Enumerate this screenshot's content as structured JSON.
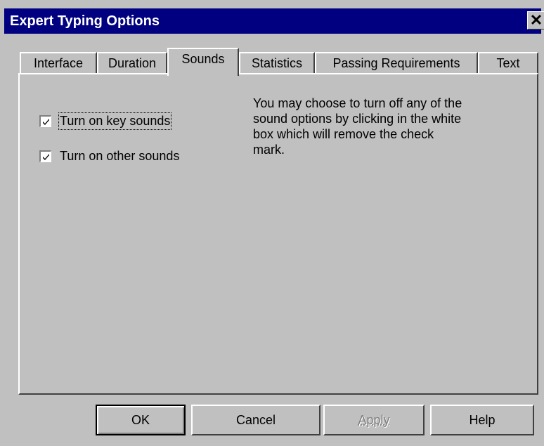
{
  "window": {
    "title": "Expert Typing Options",
    "close_glyph": "✕"
  },
  "tabs": [
    {
      "label": "Interface"
    },
    {
      "label": "Duration"
    },
    {
      "label": "Sounds",
      "active": true
    },
    {
      "label": "Statistics"
    },
    {
      "label": "Passing Requirements"
    },
    {
      "label": "Text"
    }
  ],
  "sounds": {
    "key_sounds": {
      "label": "Turn on key sounds",
      "checked": true
    },
    "other_sounds": {
      "label": "Turn on other sounds",
      "checked": true
    },
    "info_text": "You may choose to turn off any of the sound options by clicking in the white box which will remove the check mark."
  },
  "buttons": {
    "ok": "OK",
    "cancel": "Cancel",
    "apply": "Apply",
    "help": "Help"
  }
}
